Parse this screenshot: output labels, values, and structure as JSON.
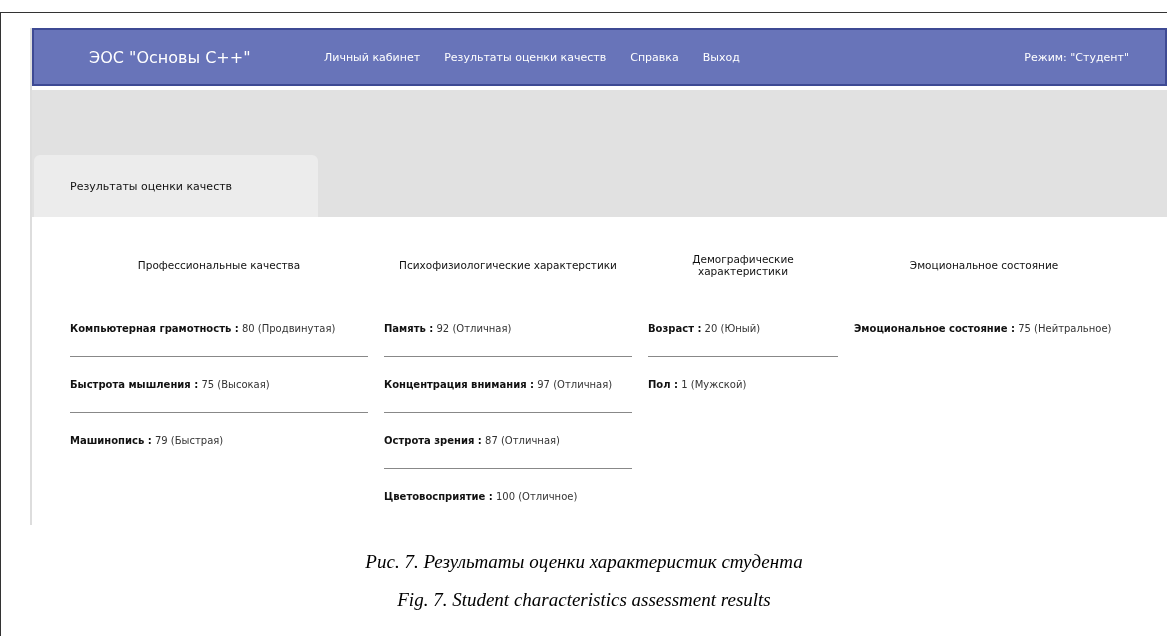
{
  "header": {
    "brand": "ЭОС \"Основы C++\"",
    "nav": [
      {
        "label": "Личный кабинет"
      },
      {
        "label": "Результаты оценки качеств"
      },
      {
        "label": "Справка"
      },
      {
        "label": "Выход"
      }
    ],
    "mode": "Режим: \"Студент\""
  },
  "tabs": [
    {
      "label": "Результаты оценки качеств",
      "selected": true
    }
  ],
  "columns": [
    {
      "title": "Профессиональные качества",
      "items": [
        "**Компьютерная грамотность :** 80 (Продвинутая)",
        "**Быстрота мышления :** 75 (Высокая)",
        "**Машинопись :** 79 (Быстрая)"
      ]
    },
    {
      "title": "Психофизиологические характерстики",
      "items": [
        "**Память :** 92 (Отличная)",
        "**Концентрация внимания :** 97 (Отличная)",
        "**Острота зрения :** 87 (Отличная)",
        "**Цветовосприятие :** 100 (Отличное)"
      ]
    },
    {
      "title": "Демографические характеристики",
      "items": [
        "**Возраст :** 20 (Юный)",
        "**Пол :** 1 (Мужской)"
      ]
    },
    {
      "title": "Эмоциональное состояние",
      "items": [
        "**Эмоциональное состояние :** 75 (Нейтральное)"
      ]
    }
  ],
  "captions": [
    "Рис. 7. Результаты оценки характеристик студента",
    "Fig. 7. Student characteristics assessment results"
  ]
}
